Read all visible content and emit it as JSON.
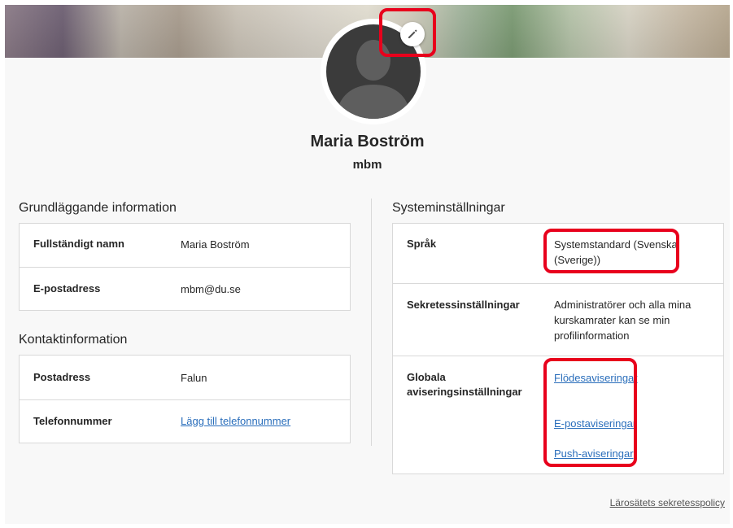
{
  "profile": {
    "name": "Maria Boström",
    "username": "mbm"
  },
  "basic_info": {
    "title": "Grundläggande information",
    "rows": [
      {
        "label": "Fullständigt namn",
        "value": "Maria Boström"
      },
      {
        "label": "E-postadress",
        "value": "mbm@du.se"
      }
    ]
  },
  "contact_info": {
    "title": "Kontaktinformation",
    "rows": [
      {
        "label": "Postadress",
        "value": "Falun"
      },
      {
        "label": "Telefonnummer",
        "link": "Lägg till telefonnummer"
      }
    ]
  },
  "system_settings": {
    "title": "Systeminställningar",
    "language": {
      "label": "Språk",
      "value": "Systemstandard (Svenska (Sverige))"
    },
    "privacy": {
      "label": "Sekretessinställningar",
      "value": "Administratörer och alla mina kurskamrater kan se min profilinformation"
    },
    "notifications": {
      "label": "Globala aviseringsinställningar",
      "links": [
        "Flödesaviseringar",
        "E-postaviseringar",
        "Push-aviseringar"
      ]
    }
  },
  "footer": {
    "privacy_policy": "Lärosätets sekretesspolicy"
  },
  "icons": {
    "edit": "pencil-icon",
    "avatar": "default-avatar-icon"
  },
  "colors": {
    "link": "#2a6ebb",
    "highlight": "#e8001c",
    "avatar": "#3b3b3b"
  }
}
